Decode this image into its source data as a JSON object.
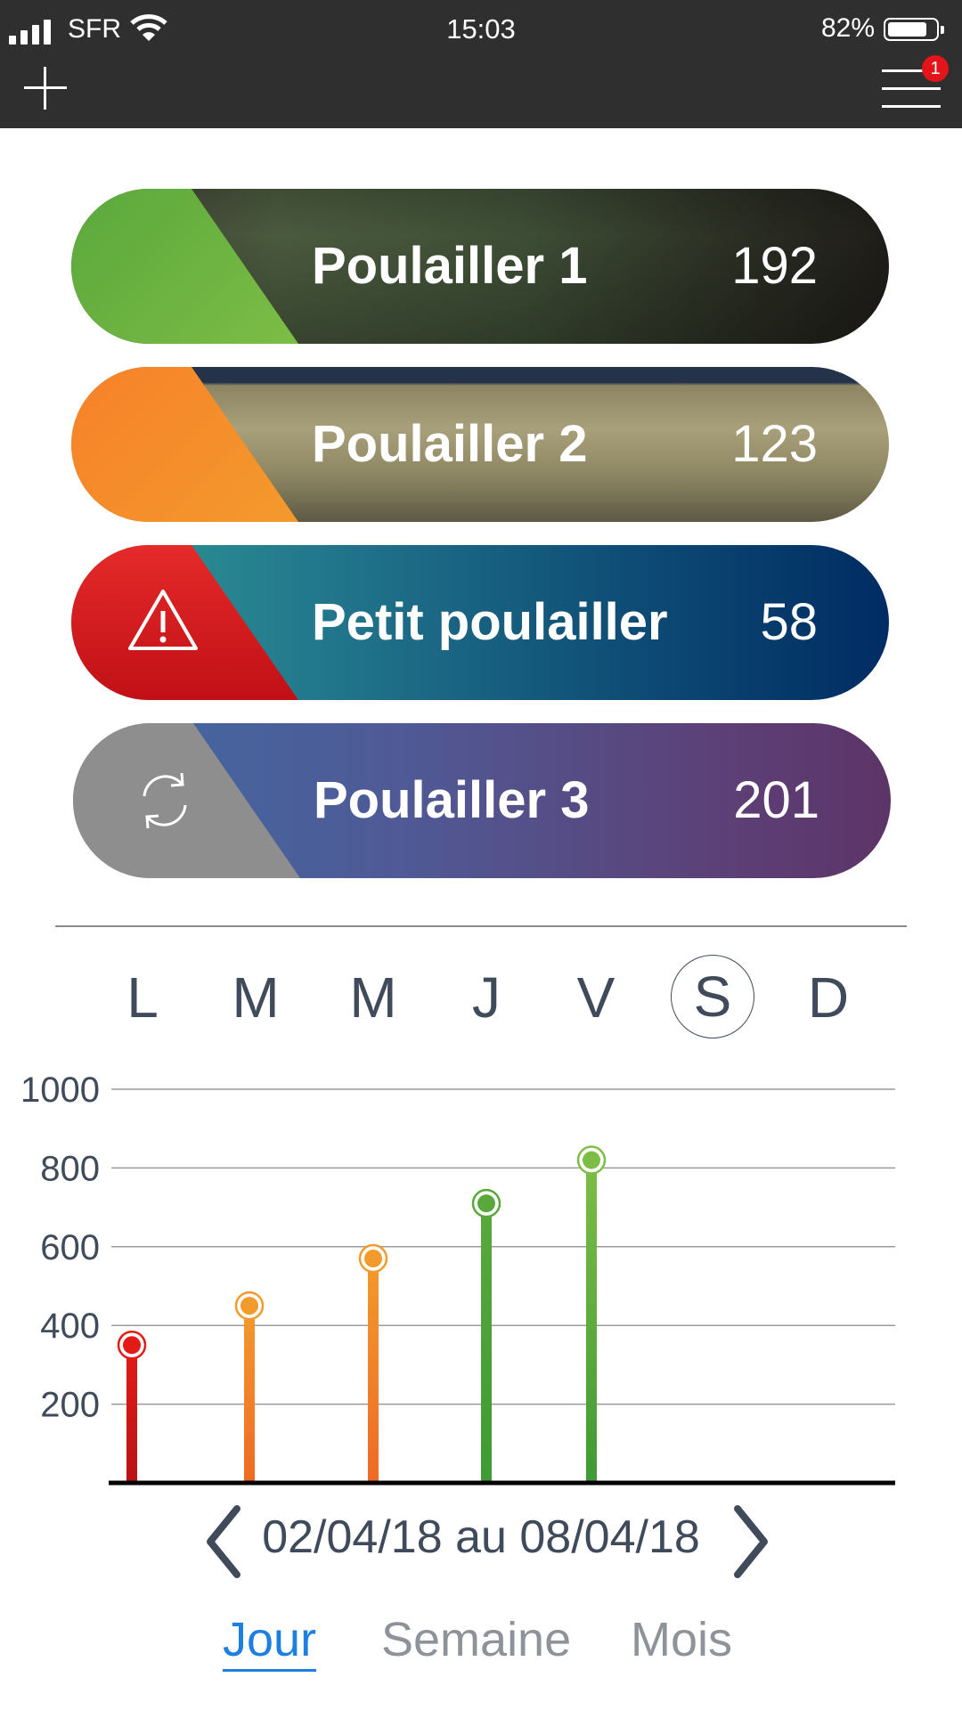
{
  "status_bar": {
    "carrier": "SFR",
    "time": "15:03",
    "battery": "82%",
    "battery_level": 0.82
  },
  "nav": {
    "add_icon": "plus-icon",
    "menu_icon": "hamburger-menu-icon",
    "notification_count": "1"
  },
  "coops": [
    {
      "name": "Poulailler 1",
      "count": "192",
      "status_color": "#6ab43e",
      "status": "ok"
    },
    {
      "name": "Poulailler 2",
      "count": "123",
      "status_color": "#f7812a",
      "status": "warning"
    },
    {
      "name": "Petit poulailler",
      "count": "58",
      "status_color": "#d71c1f",
      "status": "alert",
      "icon": "warning-triangle-icon"
    },
    {
      "name": "Poulailler 3",
      "count": "201",
      "status_color": "#8a8a8a",
      "status": "syncing",
      "icon": "refresh-icon"
    }
  ],
  "weekdays": {
    "items": [
      "L",
      "M",
      "M",
      "J",
      "V",
      "S",
      "D"
    ],
    "selected_index": 5
  },
  "chart_data": {
    "type": "bar",
    "categories": [
      "L",
      "M",
      "M",
      "J",
      "V",
      "S",
      "D"
    ],
    "values": [
      350,
      450,
      570,
      710,
      820,
      null,
      null
    ],
    "colors": [
      "#e31b17",
      "#f39a2c",
      "#f39a2c",
      "#5aa83c",
      "#7dbd46",
      null,
      null
    ],
    "ylim": [
      0,
      1000
    ],
    "yticks": [
      "200",
      "400",
      "600",
      "800",
      "1000"
    ],
    "grid": true
  },
  "date_range": {
    "text": "02/04/18 au 08/04/18",
    "prev_icon": "chevron-left-icon",
    "next_icon": "chevron-right-icon"
  },
  "tabs": {
    "items": [
      "Jour",
      "Semaine",
      "Mois"
    ],
    "active_index": 0
  }
}
